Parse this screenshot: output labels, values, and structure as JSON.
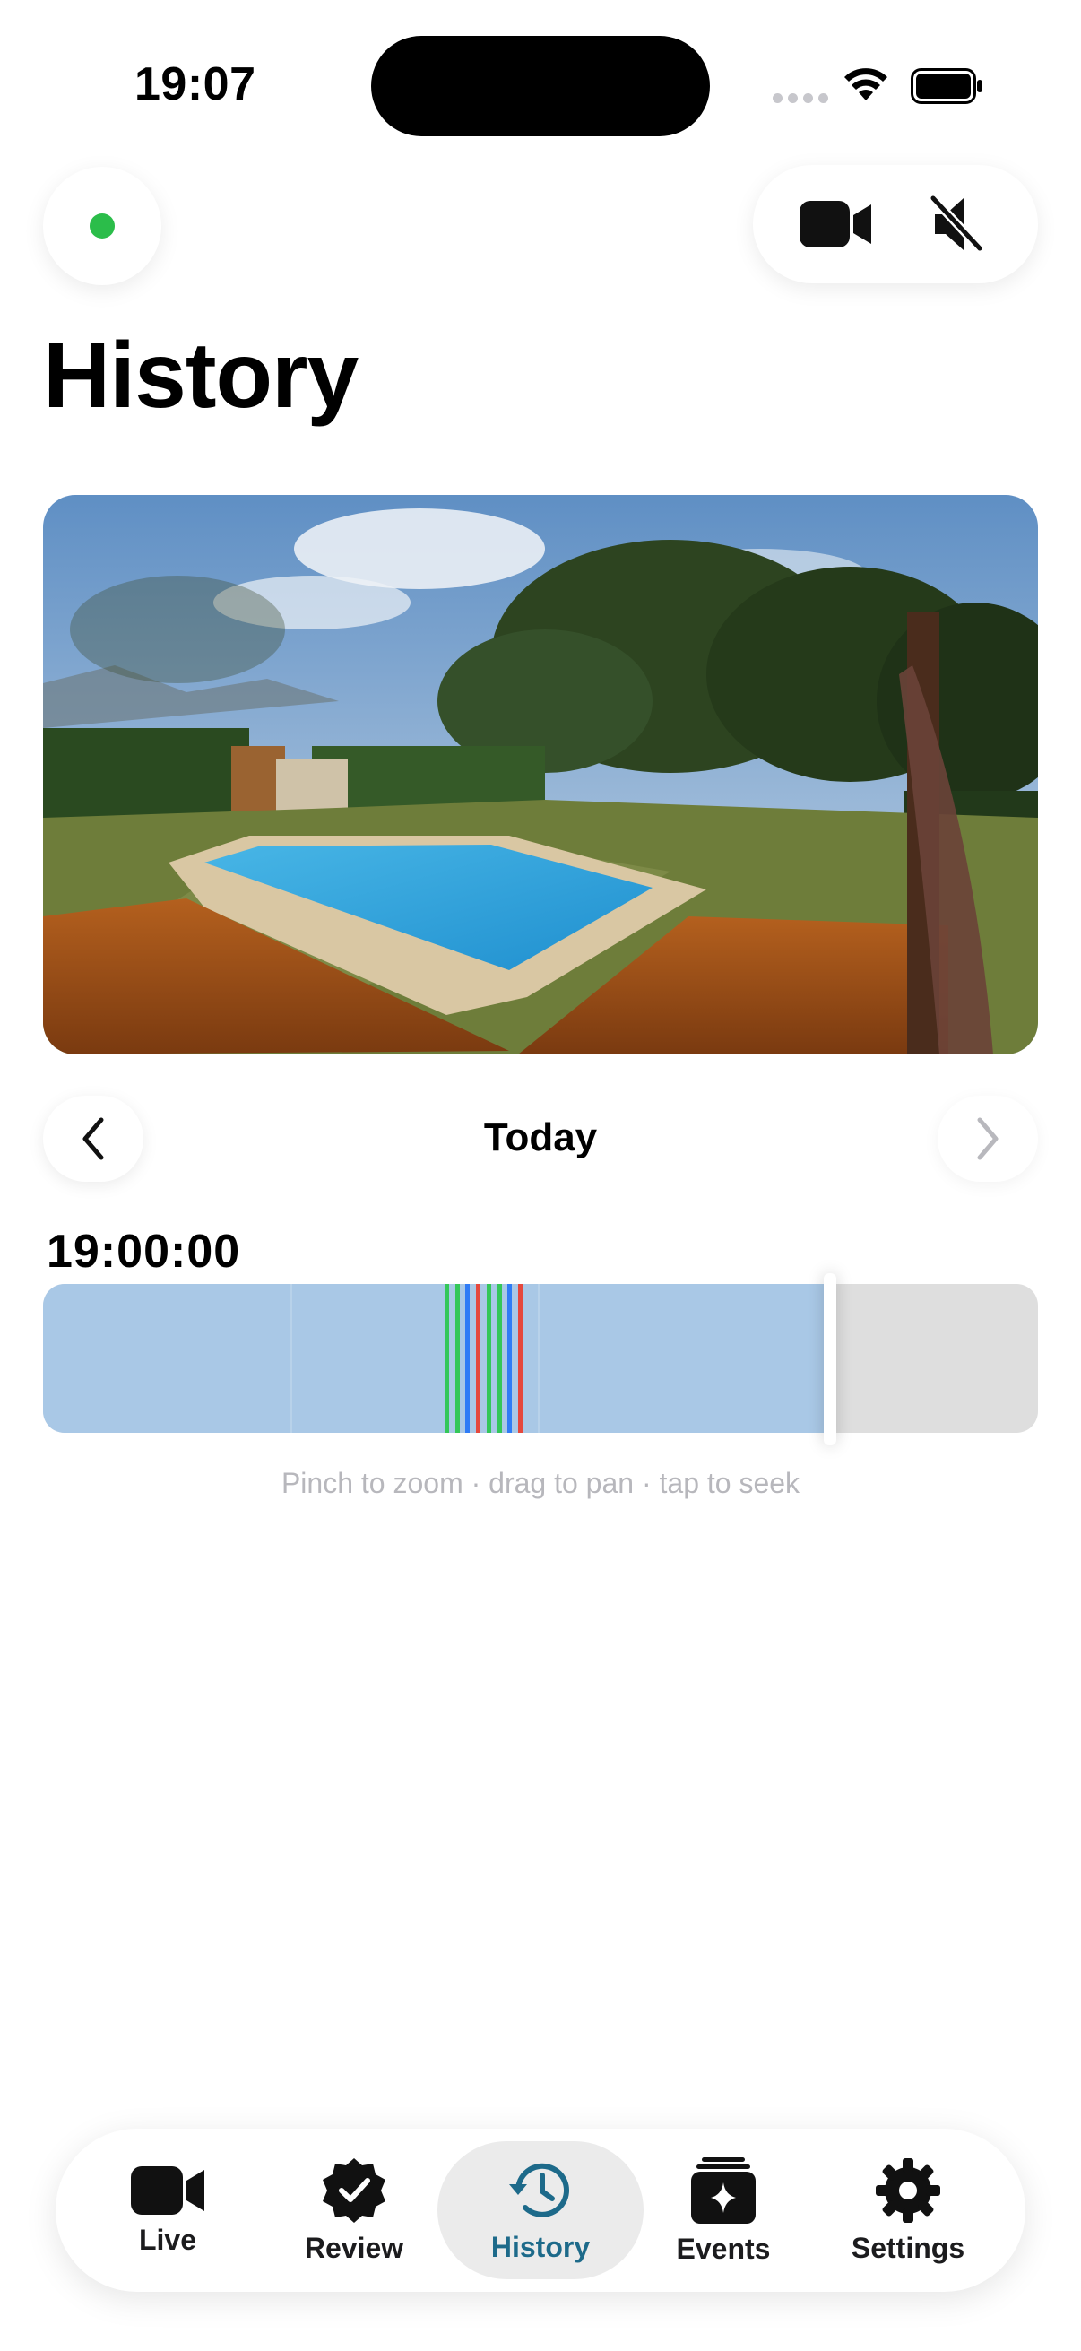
{
  "status_bar": {
    "time": "19:07"
  },
  "top_controls": {
    "status_color": "#2bbd4a",
    "buttons": [
      {
        "icon": "video-camera-icon"
      },
      {
        "icon": "speaker-muted-icon"
      }
    ]
  },
  "page": {
    "title": "History"
  },
  "camera_image": {
    "description_icon": "camera-snapshot"
  },
  "day_nav": {
    "label": "Today",
    "prev_icon": "chevron-left-icon",
    "next_icon": "chevron-right-icon"
  },
  "timeline": {
    "current_time": "19:00:00",
    "recorded_fraction": 0.797,
    "event_markers": [
      {
        "color": "#34c759"
      },
      {
        "color": "#34c759"
      },
      {
        "color": "#2f7cf6"
      },
      {
        "color": "#e5483d"
      },
      {
        "color": "#34c759"
      },
      {
        "color": "#34c759"
      },
      {
        "color": "#2f7cf6"
      },
      {
        "color": "#e5483d"
      }
    ],
    "hint": "Pinch to zoom · drag to pan · tap to seek"
  },
  "tabs": [
    {
      "label": "Live",
      "icon": "video-camera-icon",
      "active": false
    },
    {
      "label": "Review",
      "icon": "verified-badge-icon",
      "active": false
    },
    {
      "label": "History",
      "icon": "history-clock-icon",
      "active": true
    },
    {
      "label": "Events",
      "icon": "sparkle-stack-icon",
      "active": false
    },
    {
      "label": "Settings",
      "icon": "gear-icon",
      "active": false
    }
  ],
  "colors": {
    "accent": "#1d6a8a",
    "recorded": "#a9c8e6",
    "unrecorded": "#dedede"
  }
}
